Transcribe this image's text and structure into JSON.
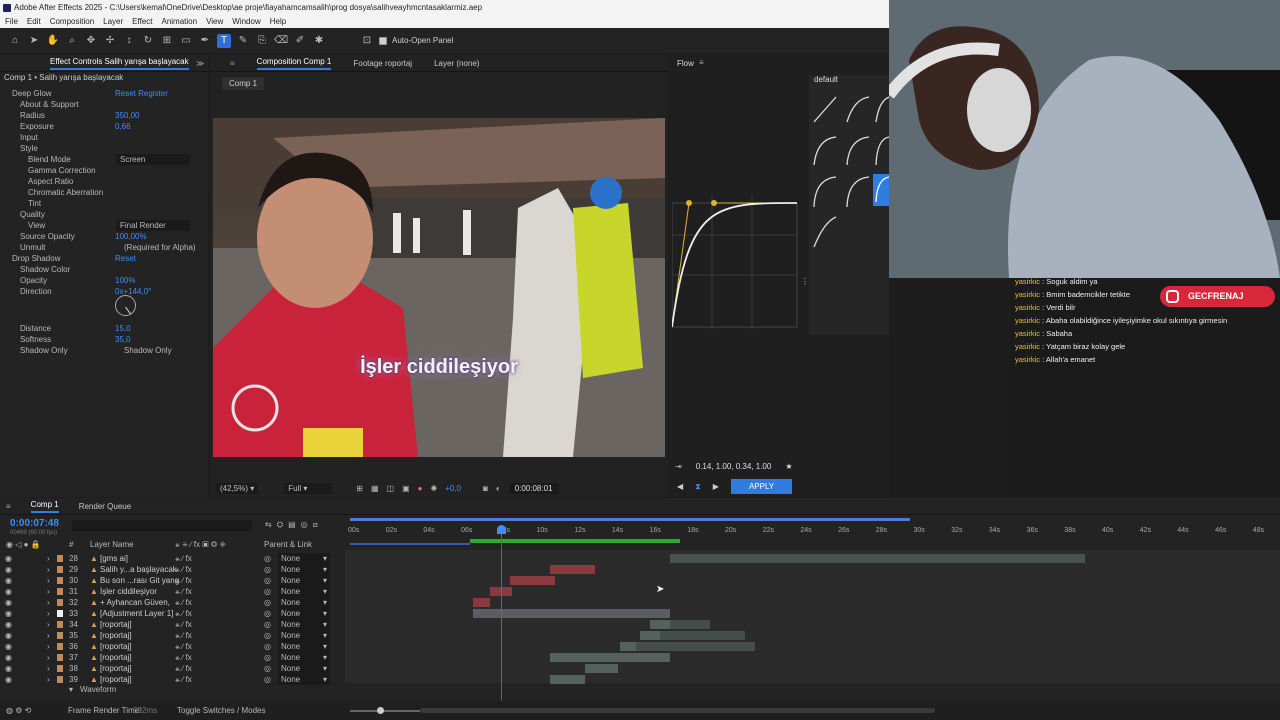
{
  "window": {
    "title": "Adobe After Effects 2025 - C:\\Users\\kemal\\OneDrive\\Desktop\\ae proje\\fiayahamcamsalih\\prog dosya\\salihveayhmcntasaklarmiz.aep"
  },
  "menu": [
    "File",
    "Edit",
    "Composition",
    "Layer",
    "Effect",
    "Animation",
    "View",
    "Window",
    "Help"
  ],
  "toolbar": {
    "auto_open_label": "Auto-Open Panel"
  },
  "effect_controls": {
    "tab_label": "Effect Controls Salih yarışa başlayacak",
    "layer_label": "Comp 1 • Salih yarışa başlayacak",
    "rows": [
      {
        "label": "Deep Glow",
        "value": "",
        "value2": "Reset    Register",
        "indent": 1,
        "fx": true
      },
      {
        "label": "About & Support",
        "value": "",
        "indent": 2
      },
      {
        "label": "Radius",
        "value": "350,00",
        "indent": 2
      },
      {
        "label": "Exposure",
        "value": "0,66",
        "indent": 2
      },
      {
        "label": "Input",
        "value": "",
        "indent": 2
      },
      {
        "label": "Style",
        "value": "",
        "indent": 2
      },
      {
        "label": "Blend Mode",
        "value": "Screen",
        "indent": 3
      },
      {
        "label": "Gamma Correction",
        "value": "",
        "indent": 3
      },
      {
        "label": "Aspect Ratio",
        "value": "",
        "indent": 3
      },
      {
        "label": "Chromatic Aberration",
        "value": "",
        "indent": 3
      },
      {
        "label": "Tint",
        "value": "",
        "indent": 3
      },
      {
        "label": "Quality",
        "value": "",
        "indent": 2
      },
      {
        "label": "View",
        "value": "Final Render",
        "indent": 3
      },
      {
        "label": "Source Opacity",
        "value": "100,00%",
        "indent": 2
      },
      {
        "label": "Unmult",
        "value": "(Required for Alpha)",
        "indent": 2
      },
      {
        "label": "Drop Shadow",
        "value": "Reset",
        "indent": 1,
        "fx": true
      },
      {
        "label": "Shadow Color",
        "value": "",
        "indent": 2
      },
      {
        "label": "Opacity",
        "value": "100%",
        "indent": 2
      },
      {
        "label": "Direction",
        "value": "0x+144,0°",
        "indent": 2
      },
      {
        "label": "Distance",
        "value": "15,0",
        "indent": 2
      },
      {
        "label": "Softness",
        "value": "35,0",
        "indent": 2
      },
      {
        "label": "Shadow Only",
        "value": "Shadow Only",
        "indent": 2
      }
    ]
  },
  "composition": {
    "tabs": [
      "Composition Comp 1",
      "Footage roportaj",
      "Layer (none)"
    ],
    "sub_tab": "Comp 1",
    "subtitle": "İşler ciddileşiyor",
    "zoom": "(42,5%)",
    "resolution": "Full",
    "exposure": "+0,0",
    "timecode": "0:00:08:01"
  },
  "flow": {
    "title": "Flow",
    "preset_group": "default",
    "presets": [
      "linear",
      "smooth",
      "",
      "quad",
      "cubic",
      "",
      "quint",
      "expoin",
      "expo",
      "back"
    ],
    "bezier": "0.14, 1.00, 0.34, 1.00",
    "apply_label": "APPLY"
  },
  "chat": {
    "badge": "GECFRENAJ",
    "messages": [
      {
        "user": "yasirkic",
        "text": "Soguk aldim ya"
      },
      {
        "user": "yasirkic",
        "text": "Bmim bademcikler tetikte"
      },
      {
        "user": "yasirkic",
        "text": "Verdi bilr"
      },
      {
        "user": "yasirkic",
        "text": "Abaha olabildiğince iyileşiyimke okul sıkıntıya girmesin"
      },
      {
        "user": "yasirkic",
        "text": "Sabaha"
      },
      {
        "user": "yasirkic",
        "text": "Yatçam biraz kolay gele"
      },
      {
        "user": "yasirkic",
        "text": "Allah'a emanet"
      }
    ]
  },
  "timeline": {
    "tabs": [
      "Comp 1",
      "Render Queue"
    ],
    "current_time": "0:00:07:48",
    "current_frames": "00469 (60.00 fps)",
    "ruler": [
      "00s",
      "02s",
      "04s",
      "06s",
      "08s",
      "10s",
      "12s",
      "14s",
      "16s",
      "18s",
      "20s",
      "22s",
      "24s",
      "26s",
      "28s",
      "30s",
      "32s",
      "34s",
      "36s",
      "38s",
      "40s",
      "42s",
      "44s",
      "46s",
      "48s"
    ],
    "columns": {
      "num": "#",
      "name": "Layer Name",
      "parent": "Parent & Link"
    },
    "layers": [
      {
        "num": "28",
        "name": "[gms ai]",
        "parent": "None",
        "color": "#c08a5a"
      },
      {
        "num": "29",
        "name": "Salih y...a başlayacak",
        "parent": "None",
        "color": "#c08a5a"
      },
      {
        "num": "30",
        "name": "Bu son ...rası Git yang",
        "parent": "None",
        "color": "#c08a5a"
      },
      {
        "num": "31",
        "name": "İşler ciddileşiyor",
        "parent": "None",
        "color": "#c08a5a"
      },
      {
        "num": "32",
        "name": "+ Ayhancan Güven,",
        "parent": "None",
        "color": "#c08a5a"
      },
      {
        "num": "33",
        "name": "[Adjustment Layer 1]",
        "parent": "None",
        "color": "#f0f0f0"
      },
      {
        "num": "34",
        "name": "[roportaj]",
        "parent": "None",
        "color": "#c08a5a"
      },
      {
        "num": "35",
        "name": "[roportaj]",
        "parent": "None",
        "color": "#c08a5a"
      },
      {
        "num": "36",
        "name": "[roportaj]",
        "parent": "None",
        "color": "#c08a5a"
      },
      {
        "num": "37",
        "name": "[roportaj]",
        "parent": "None",
        "color": "#c08a5a"
      },
      {
        "num": "38",
        "name": "[roportaj]",
        "parent": "None",
        "color": "#c08a5a"
      },
      {
        "num": "39",
        "name": "[roportaj]",
        "parent": "None",
        "color": "#c08a5a"
      }
    ],
    "waveform_label": "Waveform",
    "frame_render_label": "Frame Render Time:",
    "frame_render_value": "392ms",
    "toggle_label": "Toggle Switches / Modes"
  },
  "colors": {
    "accent": "#2f7de1",
    "label_red": "#b8323a",
    "track_gray": "#4a5250"
  }
}
